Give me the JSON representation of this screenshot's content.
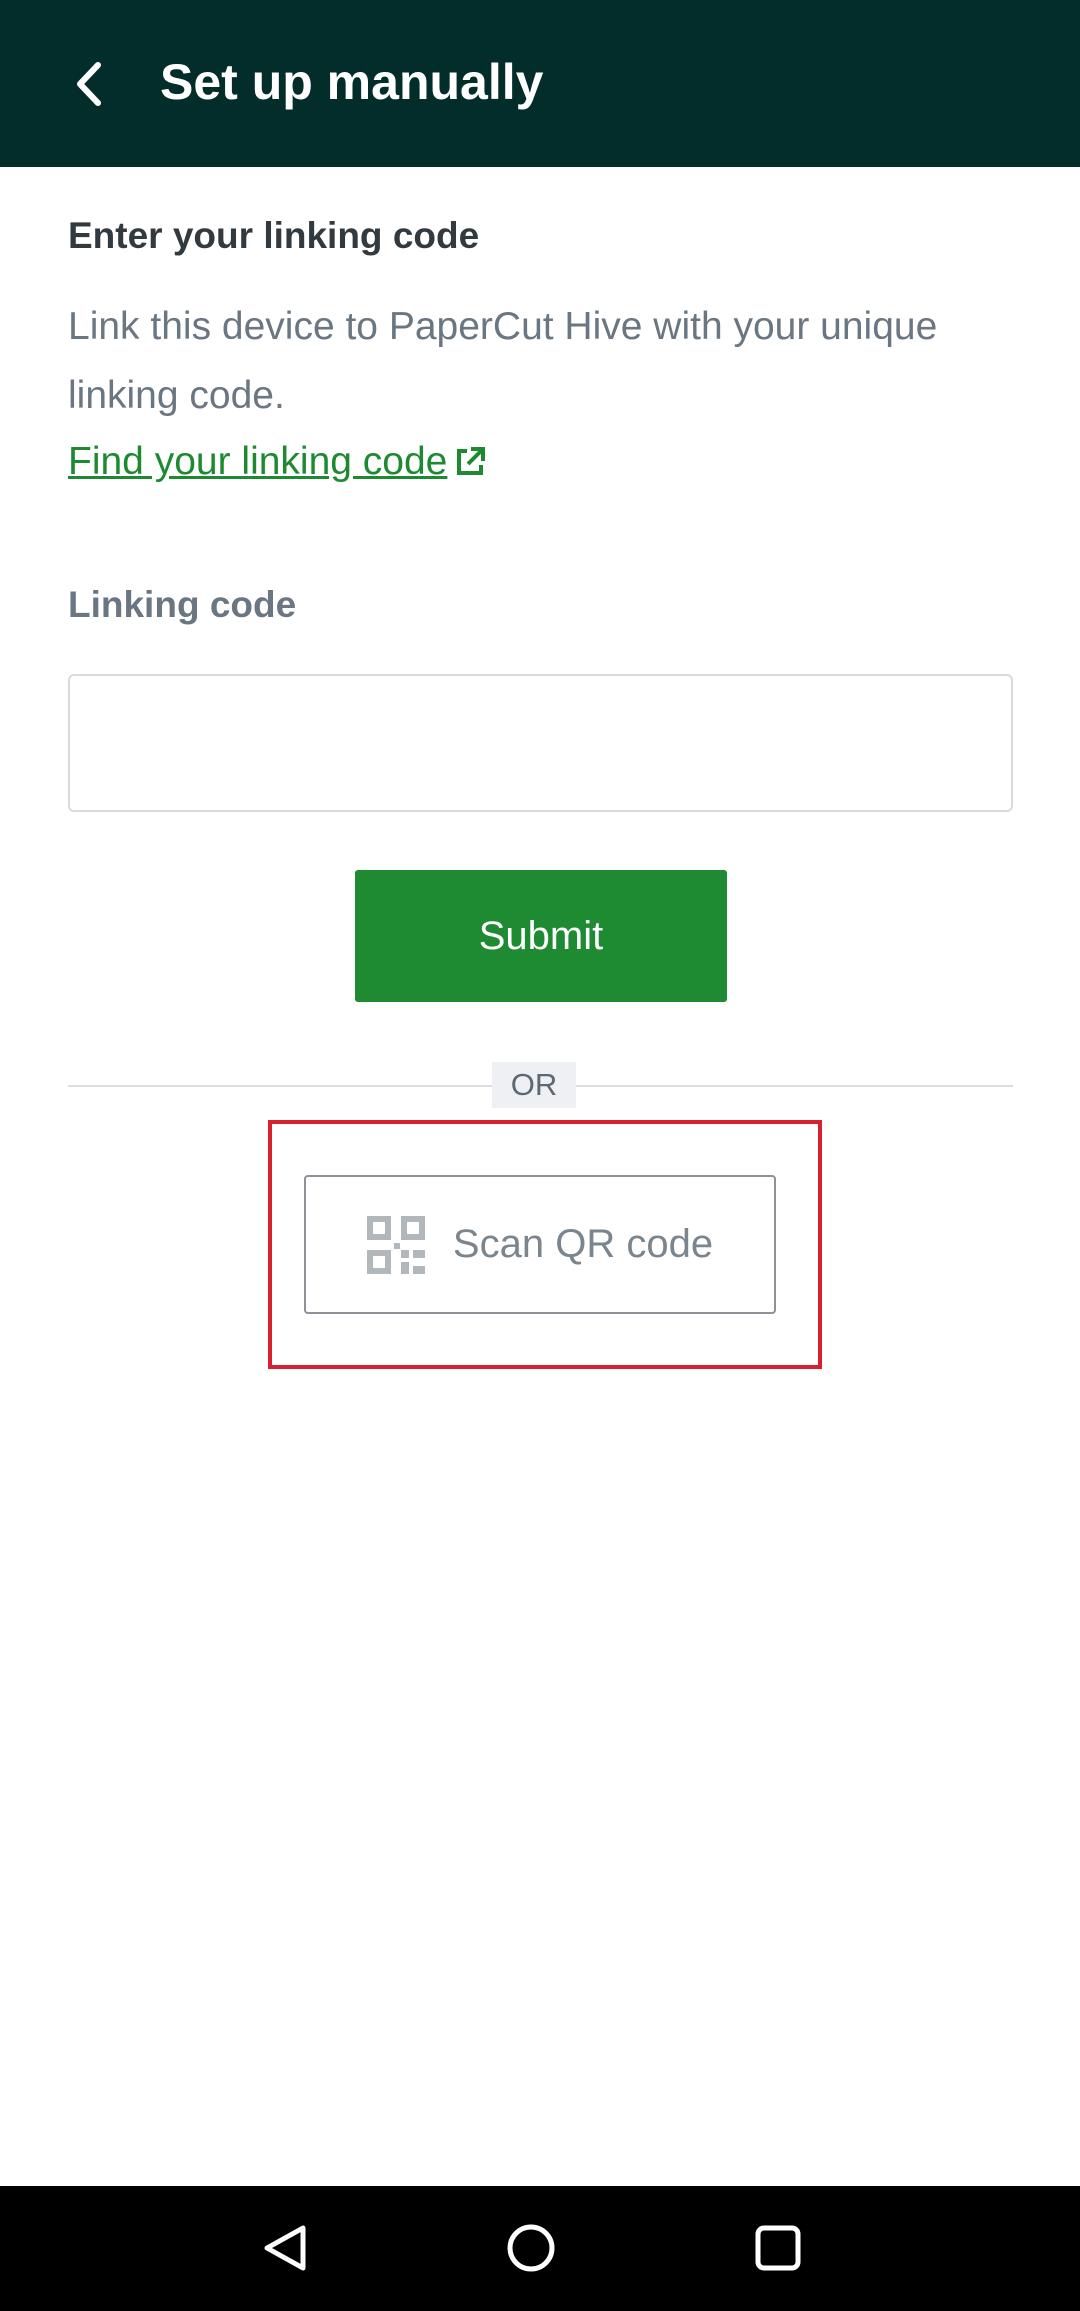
{
  "appbar": {
    "title": "Set up manually",
    "back_icon": "chevron-left-icon"
  },
  "section": {
    "title": "Enter your linking code",
    "description": "Link this device to PaperCut Hive with your unique linking code.",
    "find_link": "Find your linking code",
    "find_link_icon": "external-link-icon"
  },
  "form": {
    "label": "Linking code",
    "value": "",
    "placeholder": "",
    "submit_label": "Submit"
  },
  "separator": {
    "label": "OR"
  },
  "scan": {
    "label": "Scan QR code",
    "icon": "qr-code-icon"
  },
  "system_nav": {
    "back": "back-triangle-icon",
    "home": "home-circle-icon",
    "recents": "recents-square-icon"
  },
  "colors": {
    "appbar_bg": "#022d2b",
    "accent_green": "#1e8a32",
    "link_green": "#1d8a32",
    "highlight_red": "#d9202f",
    "text_dark": "#333a3f",
    "text_muted": "#6b7683"
  }
}
